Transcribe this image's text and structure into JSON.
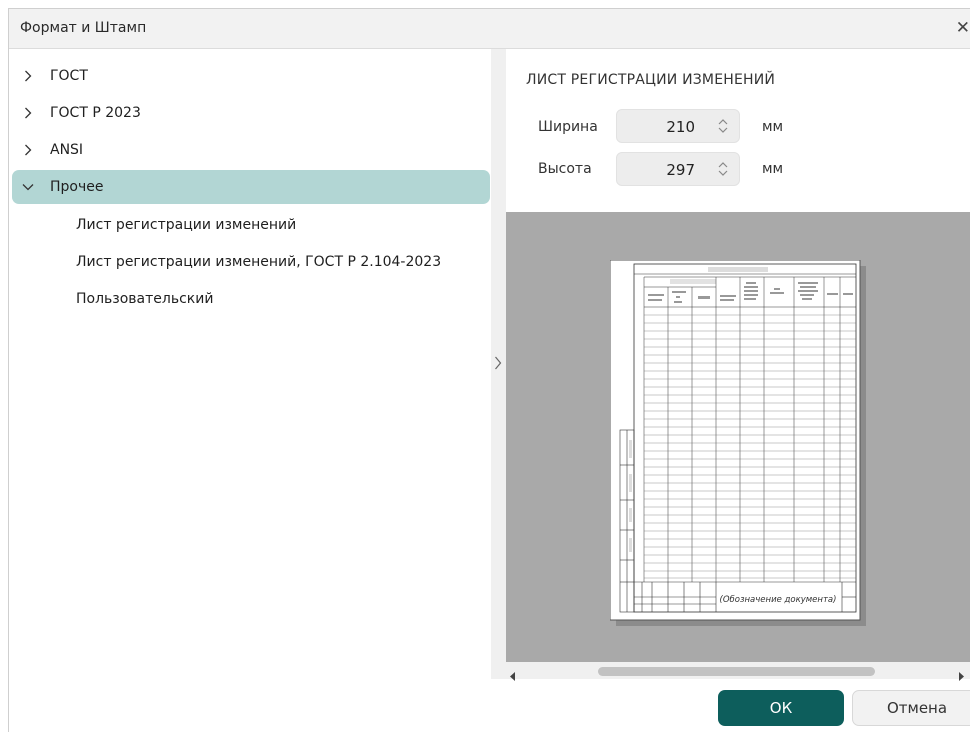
{
  "dialog": {
    "title": "Формат и Штамп",
    "close_icon": "close-icon"
  },
  "tree": {
    "items": [
      {
        "label": "ГОСТ",
        "expanded": false,
        "icon": "chevron-right-icon"
      },
      {
        "label": "ГОСТ Р 2023",
        "expanded": false,
        "icon": "chevron-right-icon"
      },
      {
        "label": "ANSI",
        "expanded": false,
        "icon": "chevron-right-icon"
      },
      {
        "label": "Прочее",
        "expanded": true,
        "selected": true,
        "icon": "chevron-down-icon",
        "children": [
          {
            "label": "Лист регистрации изменений"
          },
          {
            "label": "Лист регистрации изменений, ГОСТ Р 2.104-2023"
          },
          {
            "label": "Пользовательский"
          }
        ]
      }
    ]
  },
  "format": {
    "title": "ЛИСТ РЕГИСТРАЦИИ ИЗМЕНЕНИЙ",
    "width_label": "Ширина",
    "width_value": "210",
    "height_label": "Высота",
    "height_value": "297",
    "unit": "мм"
  },
  "preview": {
    "stamp_text": "(Обозначение документа)"
  },
  "buttons": {
    "ok": "ОК",
    "cancel": "Отмена"
  },
  "colors": {
    "selection": "#b2d6d4",
    "primary_button": "#0d5e5c",
    "preview_background": "#a9a9a9"
  }
}
